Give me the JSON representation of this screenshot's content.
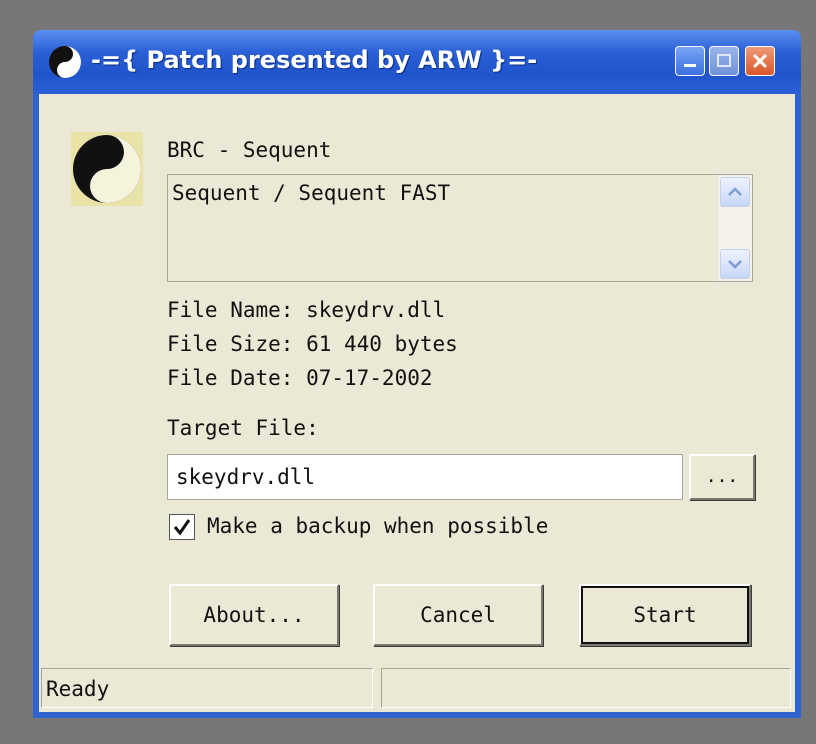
{
  "window": {
    "title": "-={ Patch presented by ARW }=-",
    "icon": "yin-yang-icon"
  },
  "titlebar_buttons": [
    "minimize-icon",
    "maximize-icon",
    "close-icon"
  ],
  "app_icon": {
    "name": "yin-yang-1-0-icon",
    "digits": [
      "1",
      "0"
    ]
  },
  "patch": {
    "title": "BRC - Sequent",
    "description": "Sequent / Sequent FAST"
  },
  "file_info": {
    "name_line": "File Name: skeydrv.dll",
    "size_line": "File Size: 61 440 bytes",
    "date_line": "File Date: 07-17-2002"
  },
  "target": {
    "label": "Target File:",
    "value": "skeydrv.dll",
    "browse_label": "..."
  },
  "backup": {
    "label": "Make a backup when possible",
    "checked": true
  },
  "buttons": {
    "about": "About...",
    "cancel": "Cancel",
    "start": "Start"
  },
  "status": {
    "text": "Ready",
    "secondary": ""
  },
  "colors": {
    "titlebar": "#2a5fd6",
    "client_bg": "#ebe9d6",
    "desktop": "#777777"
  }
}
